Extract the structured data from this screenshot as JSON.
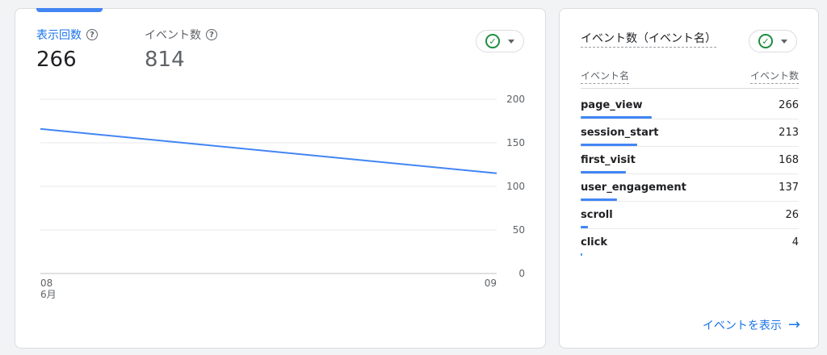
{
  "left_card": {
    "metrics": [
      {
        "label": "表示回数",
        "value": "266",
        "active": true
      },
      {
        "label": "イベント数",
        "value": "814",
        "active": false
      }
    ],
    "compare_icon": "check-circle-icon",
    "caret_icon": "caret-down-icon"
  },
  "chart_data": {
    "type": "line",
    "x": [
      "08",
      "09"
    ],
    "x_sublabels": [
      "6月",
      ""
    ],
    "series": [
      {
        "values": [
          166,
          115
        ],
        "color": "#4285f4"
      }
    ],
    "ylim": [
      0,
      200
    ],
    "yticks": [
      0,
      50,
      100,
      150,
      200
    ],
    "grid": true,
    "y_axis_side": "right"
  },
  "right_card": {
    "title": "イベント数（イベント名）",
    "col_name": "イベント名",
    "col_count": "イベント数",
    "rows": [
      {
        "name": "page_view",
        "count": "266",
        "value": 266
      },
      {
        "name": "session_start",
        "count": "213",
        "value": 213
      },
      {
        "name": "first_visit",
        "count": "168",
        "value": 168
      },
      {
        "name": "user_engagement",
        "count": "137",
        "value": 137
      },
      {
        "name": "scroll",
        "count": "26",
        "value": 26
      },
      {
        "name": "click",
        "count": "4",
        "value": 4
      }
    ],
    "view_link": "イベントを表示",
    "accent": "#1a73e8"
  }
}
